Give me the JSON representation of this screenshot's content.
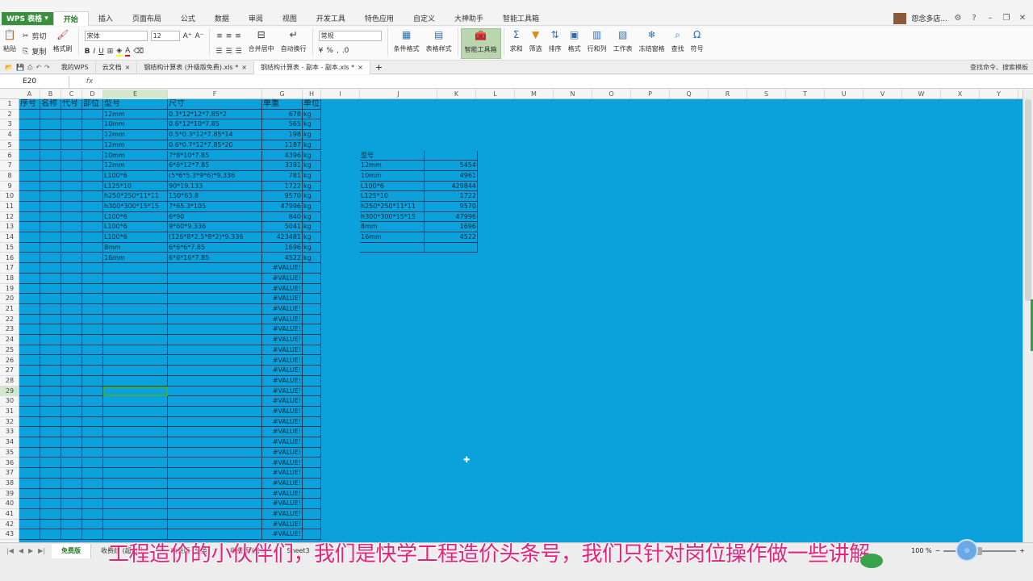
{
  "app": {
    "name": "WPS 表格"
  },
  "menu": [
    "开始",
    "插入",
    "页面布局",
    "公式",
    "数据",
    "审阅",
    "视图",
    "开发工具",
    "特色应用",
    "自定义",
    "大神助手",
    "智能工具箱"
  ],
  "menu_active": 0,
  "user": {
    "name": "怨念多店..."
  },
  "ribbon": {
    "paste": "粘贴",
    "cut": "剪切",
    "copy": "复制",
    "format_painter": "格式刷",
    "font_name": "宋体",
    "font_size": "12",
    "merge": "合并居中",
    "wrap": "自动换行",
    "number_format": "常规",
    "conditional": "条件格式",
    "table_style": "表格样式",
    "smart_toolbox": "智能工具箱",
    "sum": "求和",
    "filter": "筛选",
    "sort": "排序",
    "format": "格式",
    "rowcol": "行和列",
    "worksheet": "工作表",
    "freeze": "冻结窗格",
    "find": "查找",
    "symbol": "符号"
  },
  "doc_tabs": [
    "我的WPS",
    "云文档",
    "钢结构计算表 (升级版免费).xls *",
    "钢结构计算表 - 副本 - 副本.xls *"
  ],
  "doc_tab_active": 3,
  "search": {
    "label": "查找命令、搜索模板"
  },
  "formula_bar": {
    "namebox": "E20",
    "fx": "fx",
    "content": ""
  },
  "columns": [
    "A",
    "B",
    "C",
    "D",
    "E",
    "F",
    "G",
    "H",
    "I",
    "J",
    "K",
    "L",
    "M",
    "N",
    "O",
    "P",
    "Q",
    "R",
    "S",
    "T",
    "U",
    "V",
    "W",
    "X",
    "Y"
  ],
  "rows": [
    "1",
    "2",
    "3",
    "4",
    "5",
    "6",
    "7",
    "8",
    "9",
    "10",
    "11",
    "12",
    "13",
    "14",
    "15",
    "16",
    "17",
    "18",
    "19",
    "20",
    "21",
    "22",
    "23",
    "24",
    "25",
    "26",
    "27",
    "28",
    "29",
    "30",
    "31",
    "32",
    "33",
    "34",
    "35",
    "36",
    "37",
    "38",
    "39",
    "40",
    "41",
    "42",
    "43"
  ],
  "main_table": {
    "headers": [
      "序号",
      "名称",
      "代号",
      "部位",
      "型号",
      "尺寸",
      "单重",
      "单位"
    ],
    "rows": [
      [
        "",
        "",
        "",
        "",
        "12mm",
        "0.3*12*12*7.85*2",
        "678",
        "kg"
      ],
      [
        "",
        "",
        "",
        "",
        "10mm",
        "0.6*12*10*7.85",
        "565",
        "kg"
      ],
      [
        "",
        "",
        "",
        "",
        "12mm",
        "0.5*0.3*12*7.85*14",
        "198",
        "kg"
      ],
      [
        "",
        "",
        "",
        "",
        "12mm",
        "0.6*0.7*12*7.85*20",
        "1187",
        "kg"
      ],
      [
        "",
        "",
        "",
        "",
        "10mm",
        "7*8*10*7.85",
        "4396",
        "kg"
      ],
      [
        "",
        "",
        "",
        "",
        "12mm",
        "6*6*12*7.85",
        "3391",
        "kg"
      ],
      [
        "",
        "",
        "",
        "",
        "L100*6",
        "(5*6*5.3*9*6)*9.336",
        "781",
        "kg"
      ],
      [
        "",
        "",
        "",
        "",
        "L125*10",
        "90*19.133",
        "1722",
        "kg"
      ],
      [
        "",
        "",
        "",
        "",
        "h250*250*11*11",
        "150*63.8",
        "9570",
        "kg"
      ],
      [
        "",
        "",
        "",
        "",
        "h300*300*15*15",
        "7*65.3*105",
        "47996",
        "kg"
      ],
      [
        "",
        "",
        "",
        "",
        "L100*6",
        "6*90",
        "840",
        "kg"
      ],
      [
        "",
        "",
        "",
        "",
        "L100*6",
        "9*60*9.336",
        "5041",
        "kg"
      ],
      [
        "",
        "",
        "",
        "",
        "L100*6",
        "(126*8*2.5*8*2)*9.336",
        "423481",
        "kg"
      ],
      [
        "",
        "",
        "",
        "",
        "8mm",
        "6*6*6*7.85",
        "1696",
        "kg"
      ],
      [
        "",
        "",
        "",
        "",
        "16mm",
        "6*6*16*7.85",
        "4522",
        "kg"
      ]
    ],
    "error_value": "#VALUE!",
    "error_rows": 27
  },
  "summary_table": {
    "header": "型号",
    "rows": [
      [
        "12mm",
        "5454"
      ],
      [
        "10mm",
        "4961"
      ],
      [
        "L100*6",
        "429844"
      ],
      [
        "L125*10",
        "1722"
      ],
      [
        "h250*250*11*11",
        "9570"
      ],
      [
        "h300*300*15*15",
        "47996"
      ],
      [
        "8mm",
        "1696"
      ],
      [
        "16mm",
        "4522"
      ]
    ]
  },
  "sheets": [
    "免费版",
    "收费版 (超出比...",
    "收费版 (分类)",
    "收费版 (分...",
    "Sheet3"
  ],
  "sheet_active": 0,
  "status": {
    "zoom": "100 %"
  },
  "subtitle": "工程造价的小伙伴们，我们是快学工程造价头条号，我们只针对岗位操作做一些讲解",
  "colors": {
    "grid_bg": "#0aa1dd",
    "accent": "#3a8f3f",
    "subtitle": "#e5237a"
  }
}
